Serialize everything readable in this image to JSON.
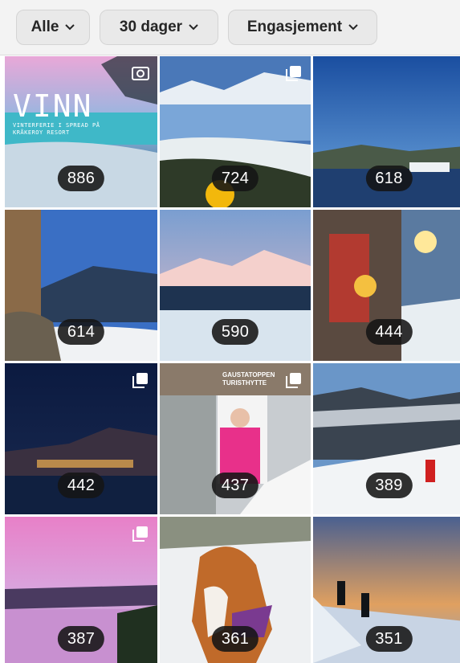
{
  "filters": [
    {
      "label": "Alle"
    },
    {
      "label": "30 dager"
    },
    {
      "label": "Engasjement"
    }
  ],
  "posts": [
    {
      "count": "886",
      "overlay_title": "VINN",
      "overlay_sub": "VINTERFERIE I SPREAD PÅ KRÅKEROY RESORT",
      "multi": "camera-icon"
    },
    {
      "count": "724",
      "multi": "carousel-icon"
    },
    {
      "count": "618"
    },
    {
      "count": "614"
    },
    {
      "count": "590"
    },
    {
      "count": "444"
    },
    {
      "count": "442",
      "multi": "carousel-icon"
    },
    {
      "count": "437",
      "sign_text": "GAUSTATOPPEN TURISTHYTTE",
      "multi": "carousel-icon"
    },
    {
      "count": "389"
    },
    {
      "count": "387",
      "multi": "carousel-icon"
    },
    {
      "count": "361"
    },
    {
      "count": "351"
    }
  ]
}
